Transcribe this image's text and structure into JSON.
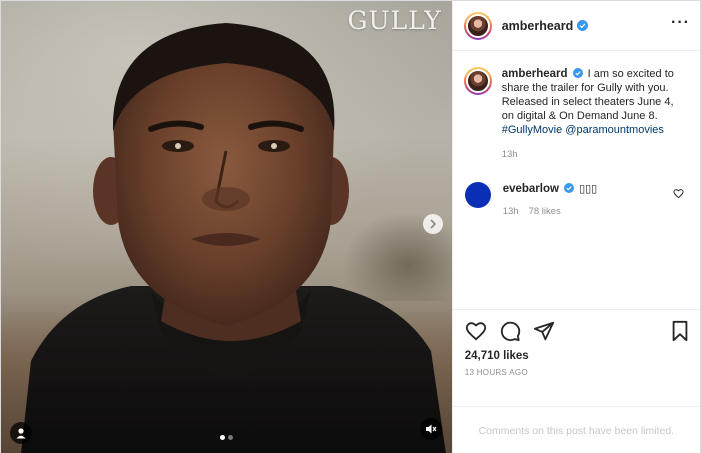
{
  "media": {
    "title_overlay": "GULLY",
    "carousel": {
      "count": 2,
      "active": 1
    },
    "icons": {
      "next": "chevron-right-icon",
      "tag": "user-tag-icon",
      "audio": "muted-speaker-icon"
    }
  },
  "header": {
    "username": "amberheard",
    "verified": true,
    "more_icon": "more-dots-icon"
  },
  "caption": {
    "username": "amberheard",
    "text": "I am so excited to share the trailer for Gully with you. Released in select theaters June 4, on digital & On Demand June 8.",
    "hashtag": "#GullyMovie",
    "mention": "@paramountmovies",
    "time": "13h"
  },
  "comments": [
    {
      "username": "evebarlow",
      "verified": true,
      "text": "▯▯▯",
      "time": "13h",
      "likes": "78 likes",
      "avatar_color": "#0a2fb6"
    }
  ],
  "actions": {
    "like_icon": "heart-icon",
    "comment_icon": "comment-icon",
    "share_icon": "share-icon",
    "save_icon": "bookmark-icon"
  },
  "likes": "24,710 likes",
  "timestamp": "13 HOURS AGO",
  "comments_limited": "Comments on this post have been limited.",
  "colors": {
    "verified": "#3897f0",
    "link": "#00376b",
    "muted_text": "#8e8e8e"
  }
}
